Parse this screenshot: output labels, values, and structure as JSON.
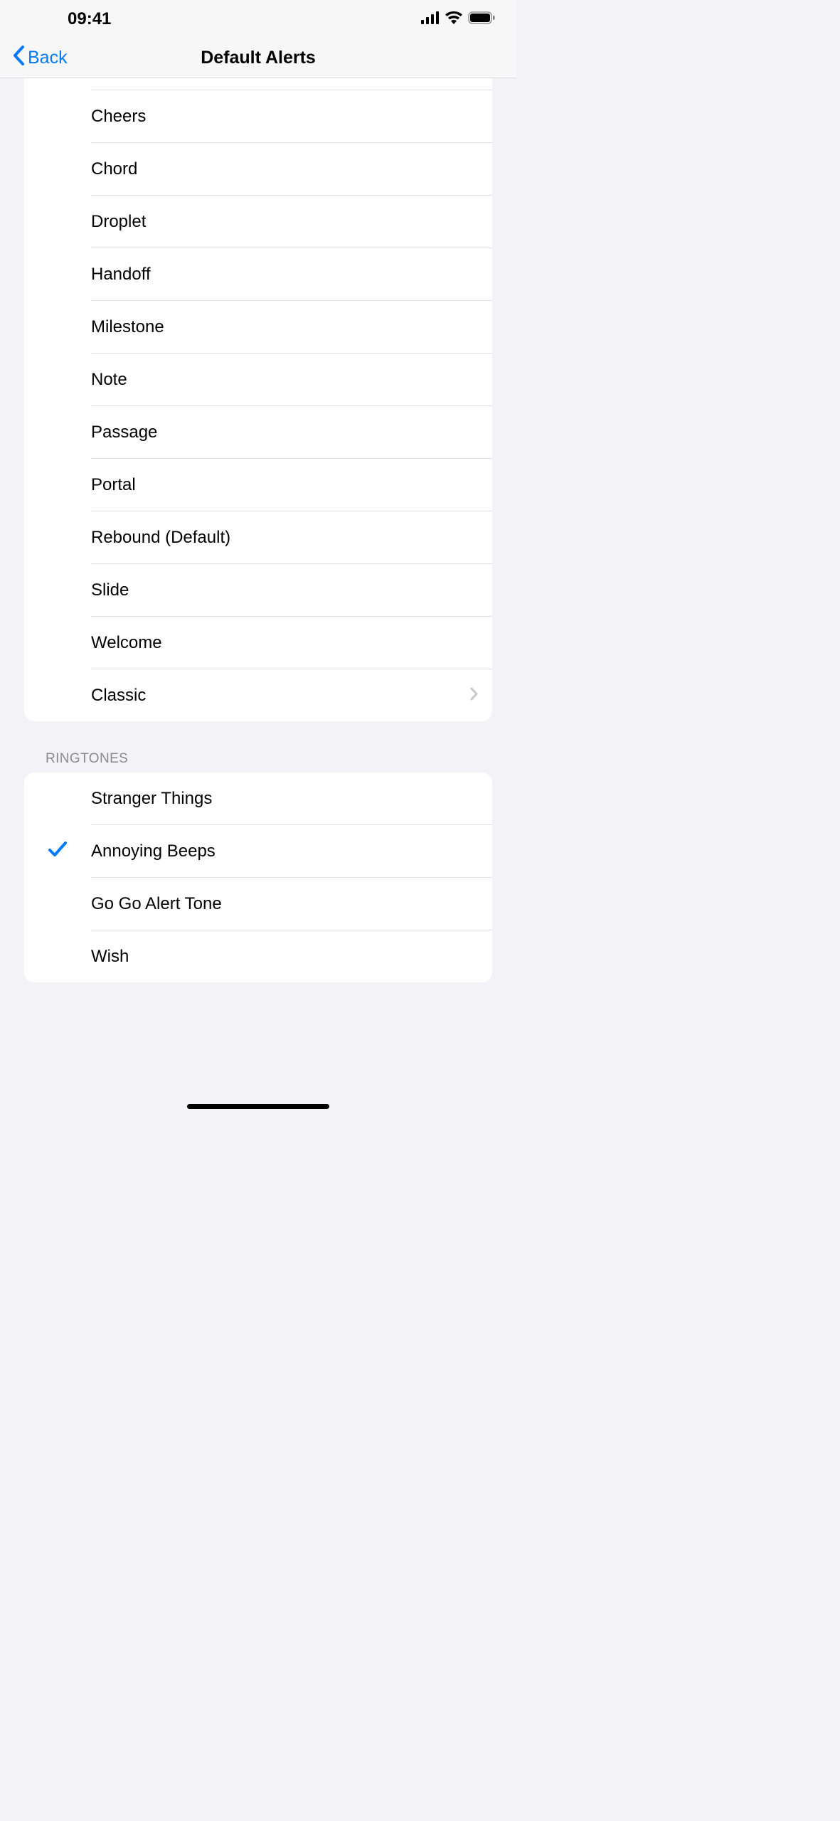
{
  "status": {
    "time": "09:41"
  },
  "nav": {
    "back_label": "Back",
    "title": "Default Alerts"
  },
  "alerts": [
    {
      "label": "Cheers"
    },
    {
      "label": "Chord"
    },
    {
      "label": "Droplet"
    },
    {
      "label": "Handoff"
    },
    {
      "label": "Milestone"
    },
    {
      "label": "Note"
    },
    {
      "label": "Passage"
    },
    {
      "label": "Portal"
    },
    {
      "label": "Rebound (Default)"
    },
    {
      "label": "Slide"
    },
    {
      "label": "Welcome"
    },
    {
      "label": "Classic",
      "disclosure": true
    }
  ],
  "ringtones_header": "RINGTONES",
  "ringtones": [
    {
      "label": "Stranger Things"
    },
    {
      "label": "Annoying Beeps",
      "selected": true
    },
    {
      "label": "Go Go Alert Tone"
    },
    {
      "label": "Wish"
    }
  ]
}
